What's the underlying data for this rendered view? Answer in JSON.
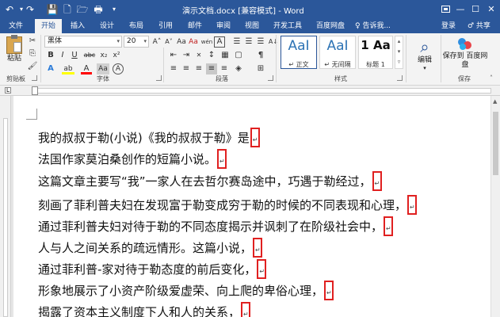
{
  "window": {
    "title": "演示文档.docx [兼容模式] - Word",
    "controls": {
      "restore": "❐",
      "minimize": "—",
      "maximize": "☐",
      "close": "✕"
    }
  },
  "quick_access": {
    "undo_icon": "↶",
    "redo_icon": "↷",
    "save_icon": "💾",
    "new_icon": "🗋",
    "open_icon": "🗁",
    "print_icon": "🖶",
    "more_icon": "▾"
  },
  "tabs": [
    {
      "label": "文件"
    },
    {
      "label": "开始"
    },
    {
      "label": "插入"
    },
    {
      "label": "设计"
    },
    {
      "label": "布局"
    },
    {
      "label": "引用"
    },
    {
      "label": "邮件"
    },
    {
      "label": "审阅"
    },
    {
      "label": "视图"
    },
    {
      "label": "开发工具"
    },
    {
      "label": "百度网盘"
    }
  ],
  "tell_me": "♀ 告诉我...",
  "sign_in": "登录",
  "share": "♂ 共享",
  "ribbon": {
    "clipboard": {
      "paste": "粘贴",
      "label": "剪贴板"
    },
    "font": {
      "font_name": "黑体",
      "font_size": "20",
      "grow": "A˄",
      "shrink": "A˅",
      "clear": "Aa",
      "wen": "wén",
      "a_box": "A",
      "bold": "B",
      "italic": "I",
      "underline": "U",
      "strike": "abc",
      "sub": "x₂",
      "sup": "x²",
      "effects": "A",
      "highlight": "ab",
      "font_color": "A",
      "aa": "Aa",
      "a_circle": "A",
      "zi": "字",
      "label": "字体"
    },
    "paragraph": {
      "label": "段落",
      "sort": "A↓",
      "marks": "¶"
    },
    "styles": {
      "items": [
        {
          "sample": "AaI",
          "name": "↵ 正文"
        },
        {
          "sample": "AaI",
          "name": "↵ 无间隔"
        },
        {
          "sample": "1 Aa",
          "name": "标题 1"
        }
      ],
      "label": "样式"
    },
    "editing": {
      "label": "编辑",
      "icon": "⌕"
    },
    "save": {
      "button": "保存到 百度网盘",
      "label": "保存"
    }
  },
  "colors": {
    "brand": "#2b579a",
    "highlight": "#ffff00",
    "font_red": "#ff0000",
    "mark_border": "#e02020"
  },
  "document": {
    "lines": [
      {
        "text": "我的叔叔于勒(小说)《我的叔叔于勒》是"
      },
      {
        "text": "法国作家莫泊桑创作的短篇小说。"
      },
      {
        "text": "这篇文章主要写“我”一家人在去哲尔赛岛途中，巧遇于勒经过，"
      },
      {
        "text": "刻画了菲利普夫妇在发现富于勒变成穷于勒的时候的不同表现和心理，"
      },
      {
        "text": "通过菲利普夫妇对待于勒的不同态度揭示并讽刺了在阶级社会中，"
      },
      {
        "text": "人与人之间关系的疏远情形。这篇小说，"
      },
      {
        "text": "通过菲利普-家对待于勒态度的前后变化，"
      },
      {
        "text": "形象地展示了小资产阶级爱虚荣、向上爬的卑俗心理，"
      },
      {
        "text": "揭露了资本主义制度下人和人的关系，"
      }
    ],
    "paragraph_mark": "↵"
  }
}
